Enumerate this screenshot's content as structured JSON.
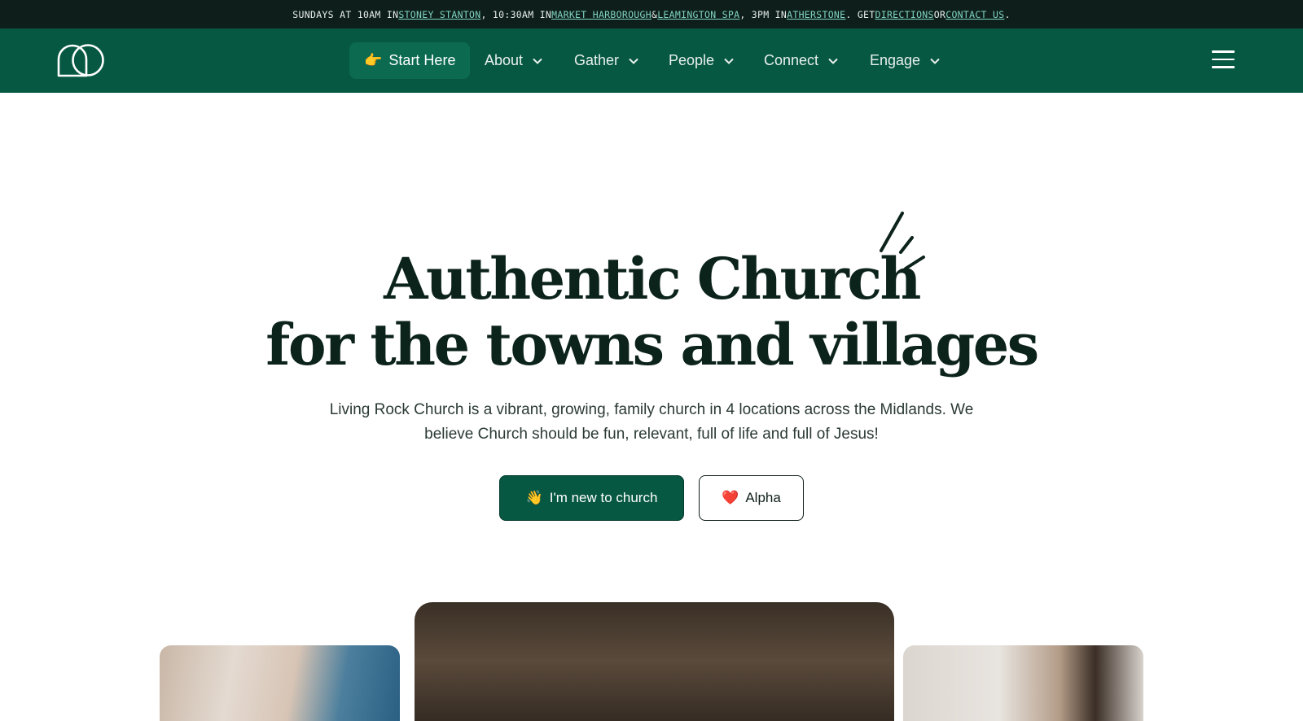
{
  "announcement": {
    "t1": "SUNDAYS AT 10AM IN ",
    "link_stoney": "STONEY STANTON",
    "t2": ", 10:30AM IN ",
    "link_market": "MARKET HARBOROUGH",
    "t3": " & ",
    "link_leamington": "LEAMINGTON SPA",
    "t4": ", 3PM IN ",
    "link_atherstone": "ATHERSTONE",
    "t5": ". GET ",
    "link_directions": "DIRECTIONS",
    "t6": " OR ",
    "link_contact": "CONTACT US",
    "t7": "."
  },
  "nav": {
    "logo_icon": "living-rock-logo",
    "start_here_emoji": "👉",
    "start_here": "Start Here",
    "items": [
      {
        "label": "About"
      },
      {
        "label": "Gather"
      },
      {
        "label": "People"
      },
      {
        "label": "Connect"
      },
      {
        "label": "Engage"
      }
    ],
    "menu_icon": "hamburger-icon"
  },
  "hero": {
    "title_line1": "Authentic Church",
    "title_line2": "for the towns and villages",
    "subtitle": "Living Rock Church is a vibrant, growing, family church in 4 locations across the Midlands. We believe Church should be fun, relevant, full of life and full of Jesus!",
    "primary_button_emoji": "👋",
    "primary_button": "I'm new to church",
    "secondary_button_emoji": "❤️",
    "secondary_button": "Alpha"
  },
  "colors": {
    "brand_green": "#075842",
    "topbar_bg": "#0e1f1b",
    "link": "#7fd3c1"
  }
}
